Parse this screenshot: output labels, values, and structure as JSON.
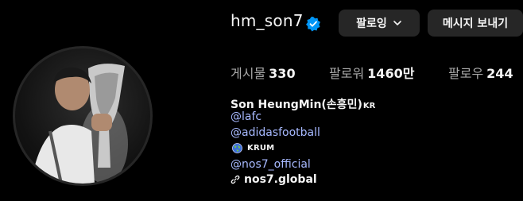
{
  "profile": {
    "username": "hm_son7",
    "verified_icon": "verified-badge-icon",
    "follow_button_label": "팔로잉",
    "message_button_label": "메시지 보내기"
  },
  "stats": {
    "posts_label": "게시물",
    "posts_count": "330",
    "followers_label": "팔로워",
    "followers_count": "1460만",
    "following_label": "팔로우",
    "following_count": "244"
  },
  "bio": {
    "name": "Son HeungMin(손흥민)",
    "name_suffix": "KR",
    "links": [
      "@lafc",
      "@adidasfootball"
    ],
    "krum_label": "KRUM",
    "nos7_link": "@nos7_official",
    "website": "nos7.global"
  },
  "colors": {
    "background": "#000000",
    "button_bg": "#262626",
    "link": "#a7b9ff",
    "verified": "#0095f6",
    "muted_text": "#a8a8a8"
  }
}
